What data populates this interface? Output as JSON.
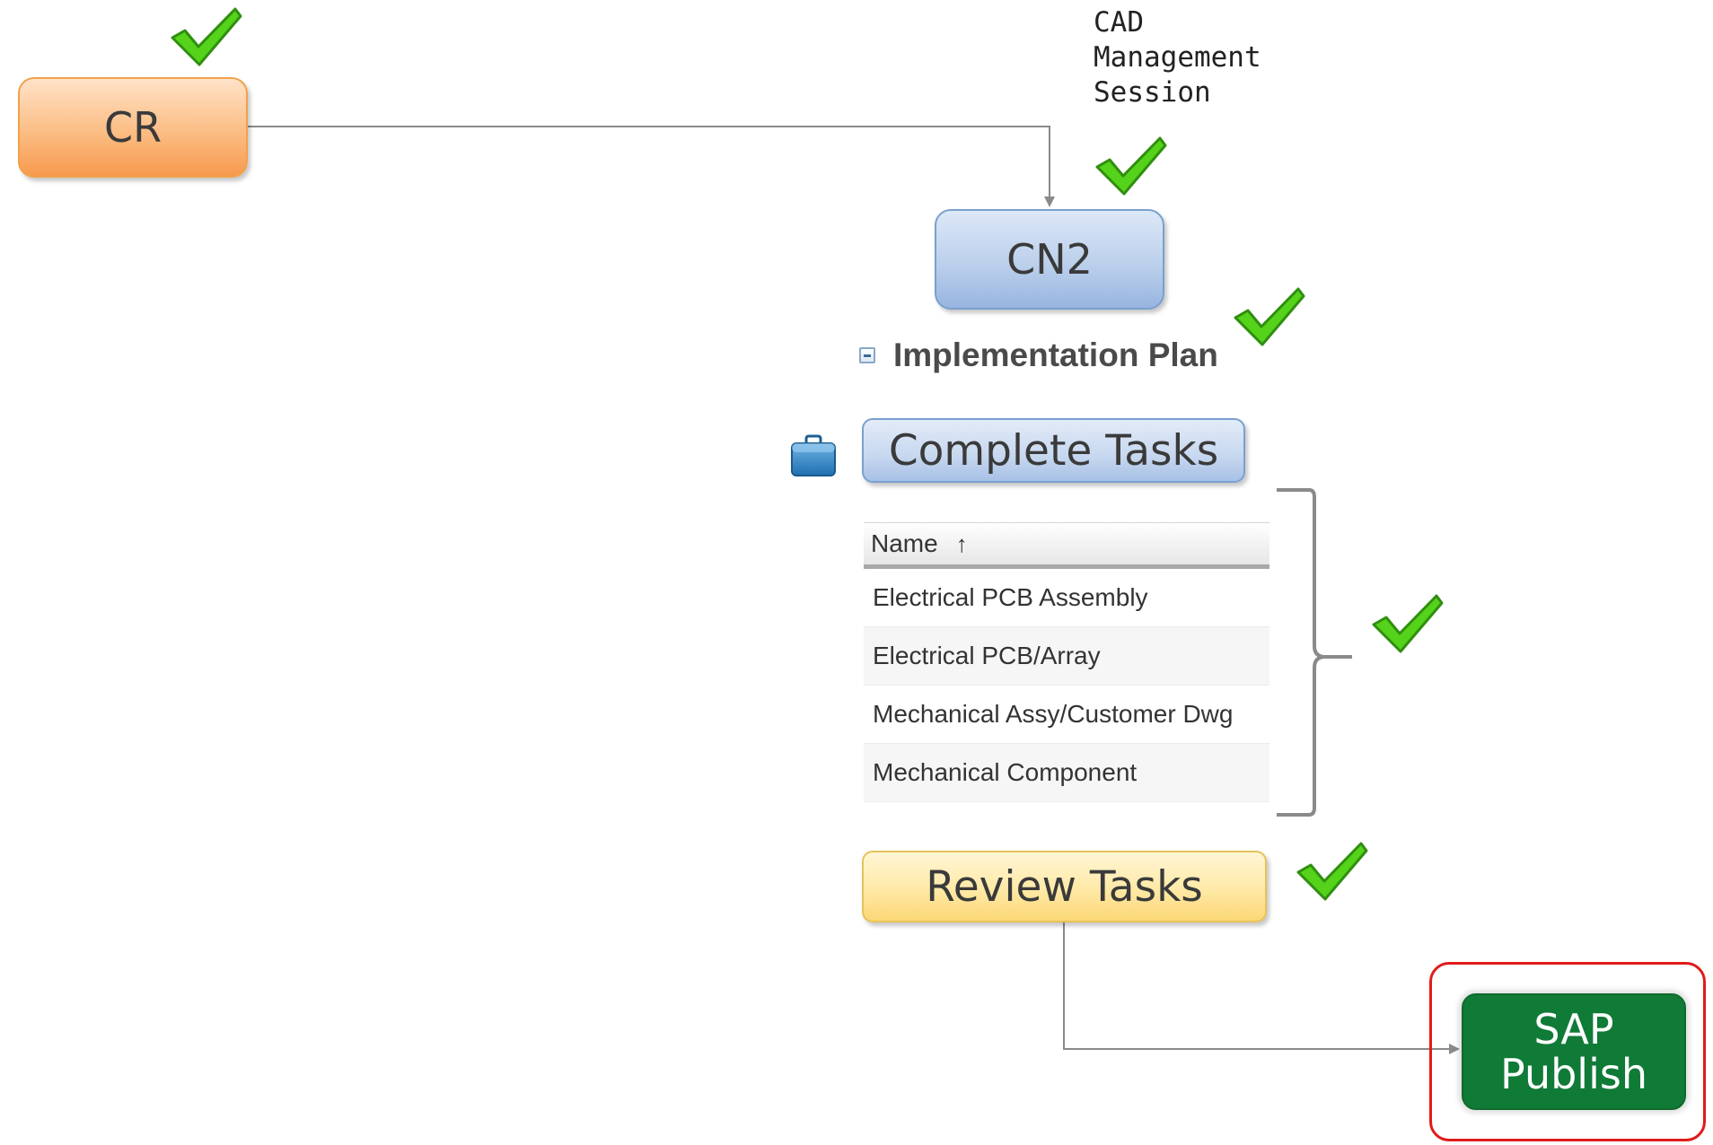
{
  "cr": {
    "label": "CR"
  },
  "cad_session": {
    "lines": [
      "CAD",
      "Management",
      "Session"
    ]
  },
  "cn2": {
    "label": "CN2"
  },
  "implementation_plan": {
    "title": "Implementation Plan"
  },
  "complete_tasks": {
    "label": "Complete Tasks"
  },
  "task_table": {
    "header": "Name",
    "sort_indicator": "↑",
    "rows": [
      "Electrical PCB Assembly",
      "Electrical PCB/Array",
      "Mechanical Assy/Customer Dwg",
      "Mechanical Component"
    ]
  },
  "review_tasks": {
    "label": "Review Tasks"
  },
  "sap_publish": {
    "lines": [
      "SAP",
      "Publish"
    ]
  },
  "colors": {
    "checkmark": "#55d21a",
    "highlight": "#e11b1b",
    "sap_green": "#107a37",
    "connector": "#8a8a8a"
  }
}
